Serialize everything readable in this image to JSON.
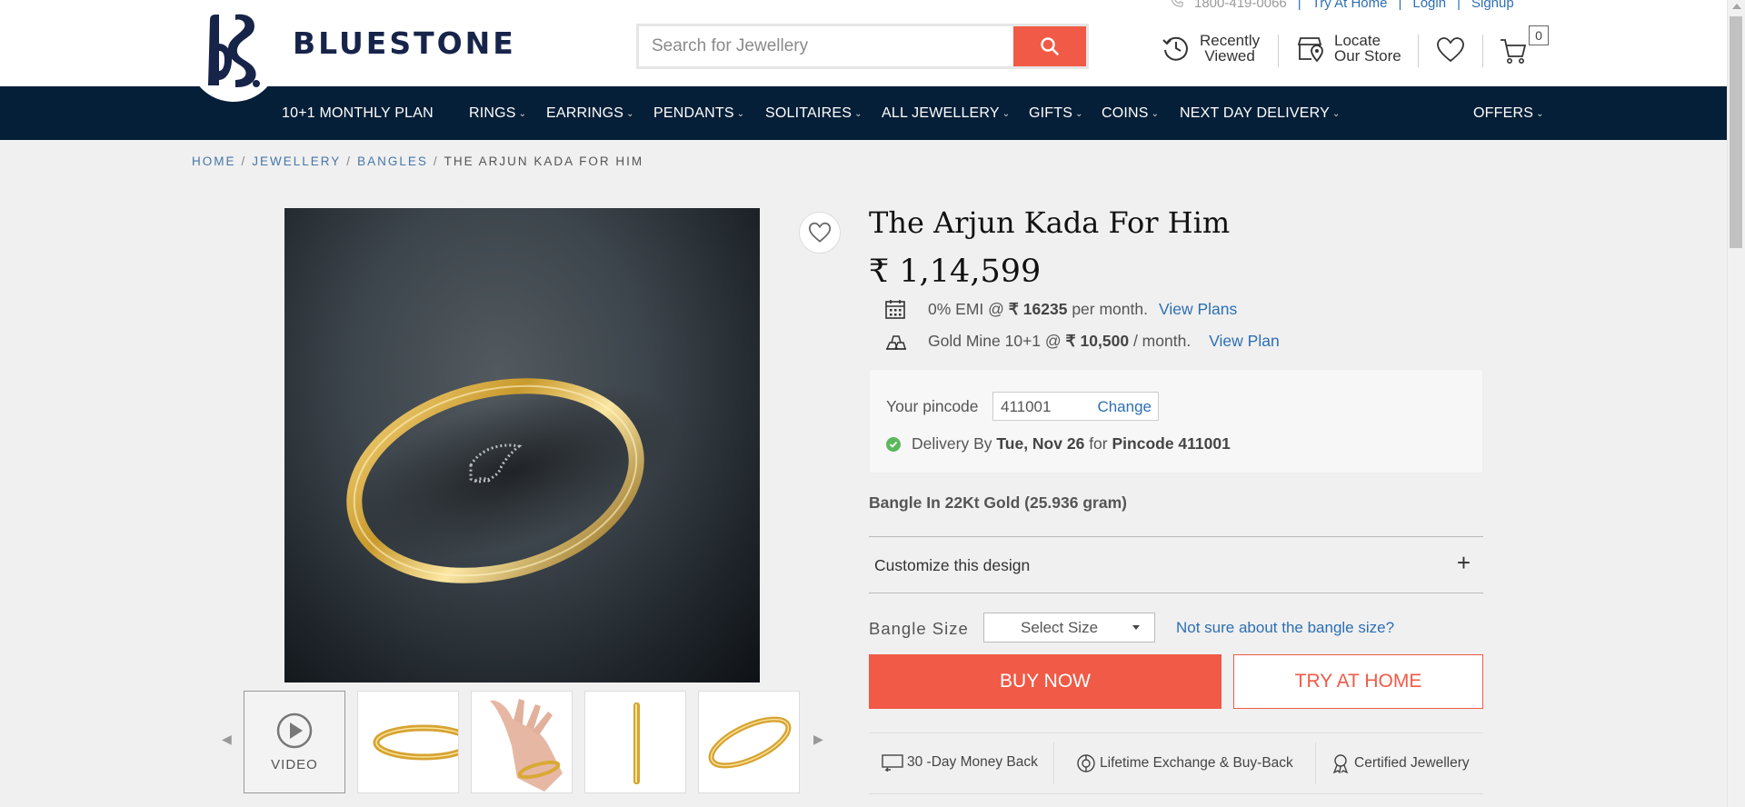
{
  "brand": {
    "name": "BLUESTONE"
  },
  "search": {
    "placeholder": "Search for Jewellery"
  },
  "toplinks": {
    "phone": "1800-419-0066",
    "try_at_home": "Try At Home",
    "login": "Login",
    "signup": "Signup",
    "separator": "|"
  },
  "header": {
    "recently_viewed_1": "Recently",
    "recently_viewed_2": "Viewed",
    "locate_1": "Locate",
    "locate_2": "Our Store",
    "cart_count": "0"
  },
  "nav": {
    "items": [
      "10+1 MONTHLY PLAN",
      "RINGS",
      "EARRINGS",
      "PENDANTS",
      "SOLITAIRES",
      "ALL JEWELLERY",
      "GIFTS",
      "COINS",
      "NEXT DAY DELIVERY",
      "OFFERS"
    ]
  },
  "breadcrumb": {
    "items": [
      "HOME",
      "JEWELLERY",
      "BANGLES"
    ],
    "current": "THE ARJUN KADA FOR HIM",
    "separator": "/"
  },
  "product": {
    "title": "The Arjun Kada For Him",
    "price": "₹ 1,14,599",
    "emi_prefix": "0% EMI @",
    "emi_amount": "₹ 16235",
    "emi_suffix": "per month.",
    "emi_link": "View Plans",
    "goldmine_prefix": "Gold Mine 10+1 @",
    "goldmine_amount": "₹ 10,500",
    "goldmine_suffix": "/ month.",
    "goldmine_link": "View Plan",
    "metal_info": "Bangle In 22Kt Gold (25.936 gram)"
  },
  "pincode": {
    "label": "Your pincode",
    "value": "411001",
    "change": "Change",
    "delivery_prefix": "Delivery By",
    "delivery_date": "Tue, Nov 26",
    "delivery_mid": "for",
    "delivery_pincode": "Pincode 411001"
  },
  "customize": {
    "label": "Customize this design",
    "toggle": "+"
  },
  "size": {
    "label": "Bangle Size",
    "selected": "Select Size",
    "help": "Not sure about the bangle size?"
  },
  "actions": {
    "buy_now": "BUY NOW",
    "try_at_home": "TRY AT HOME"
  },
  "assurances": [
    "30 -Day Money Back",
    "Lifetime Exchange & Buy-Back",
    "Certified Jewellery"
  ],
  "gallery": {
    "video_label": "VIDEO"
  },
  "colors": {
    "accent": "#f15a46",
    "navy": "#061f38",
    "link": "#2d6fb4",
    "brand": "#17244a",
    "gold": "#d9a935"
  }
}
